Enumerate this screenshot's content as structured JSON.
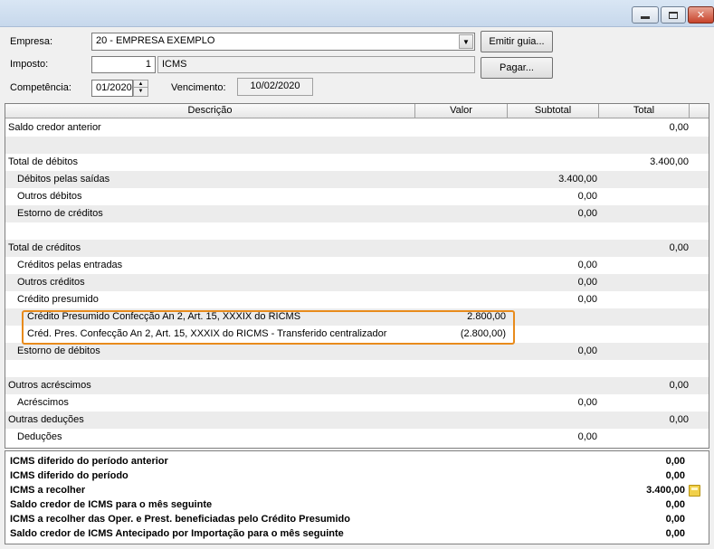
{
  "window": {
    "min_glyph": "",
    "close_glyph": "✕"
  },
  "form": {
    "empresa_label": "Empresa:",
    "empresa_value": "20 - EMPRESA EXEMPLO",
    "imposto_label": "Imposto:",
    "imposto_code": "1",
    "imposto_name": "ICMS",
    "competencia_label": "Competência:",
    "competencia_value": "01/2020",
    "vencimento_label": "Vencimento:",
    "vencimento_value": "10/02/2020",
    "emitir_button": "Emitir guia...",
    "pagar_button": "Pagar..."
  },
  "grid": {
    "columns": [
      "Descrição",
      "Valor",
      "Subtotal",
      "Total"
    ],
    "rows": [
      {
        "desc": "Saldo credor anterior",
        "valor": "",
        "subtotal": "",
        "total": "0,00"
      },
      {
        "desc": "",
        "valor": "",
        "subtotal": "",
        "total": ""
      },
      {
        "desc": "Total de débitos",
        "valor": "",
        "subtotal": "",
        "total": "3.400,00"
      },
      {
        "desc": "Débitos pelas saídas",
        "valor": "",
        "subtotal": "3.400,00",
        "total": ""
      },
      {
        "desc": "Outros débitos",
        "valor": "",
        "subtotal": "0,00",
        "total": ""
      },
      {
        "desc": "Estorno de créditos",
        "valor": "",
        "subtotal": "0,00",
        "total": ""
      },
      {
        "desc": "",
        "valor": "",
        "subtotal": "",
        "total": ""
      },
      {
        "desc": "Total de créditos",
        "valor": "",
        "subtotal": "",
        "total": "0,00"
      },
      {
        "desc": "Créditos pelas entradas",
        "valor": "",
        "subtotal": "0,00",
        "total": ""
      },
      {
        "desc": "Outros créditos",
        "valor": "",
        "subtotal": "0,00",
        "total": ""
      },
      {
        "desc": "Crédito presumido",
        "valor": "",
        "subtotal": "0,00",
        "total": ""
      },
      {
        "desc": "Crédito Presumido Confecção An 2, Art. 15, XXXIX do RICMS",
        "valor": "2.800,00",
        "subtotal": "",
        "total": ""
      },
      {
        "desc": "Créd. Pres. Confecção An 2, Art. 15, XXXIX do RICMS - Transferido centralizador",
        "valor": "(2.800,00)",
        "subtotal": "",
        "total": ""
      },
      {
        "desc": "Estorno de débitos",
        "valor": "",
        "subtotal": "0,00",
        "total": ""
      },
      {
        "desc": "",
        "valor": "",
        "subtotal": "",
        "total": ""
      },
      {
        "desc": "Outros acréscimos",
        "valor": "",
        "subtotal": "",
        "total": "0,00"
      },
      {
        "desc": "Acréscimos",
        "valor": "",
        "subtotal": "0,00",
        "total": ""
      },
      {
        "desc": "Outras deduções",
        "valor": "",
        "subtotal": "",
        "total": "0,00"
      },
      {
        "desc": "Deduções",
        "valor": "",
        "subtotal": "0,00",
        "total": ""
      }
    ]
  },
  "summary": [
    {
      "label": "ICMS diferido do período anterior",
      "value": "0,00"
    },
    {
      "label": "ICMS diferido do período",
      "value": "0,00"
    },
    {
      "label": "ICMS a recolher",
      "value": "3.400,00"
    },
    {
      "label": "Saldo credor de ICMS para o mês seguinte",
      "value": "0,00"
    },
    {
      "label": "ICMS a recolher das Oper. e Prest. beneficiadas pelo Crédito Presumido",
      "value": "0,00"
    },
    {
      "label": "Saldo credor de ICMS Antecipado por Importação para o mês seguinte",
      "value": "0,00"
    }
  ],
  "icons": {
    "calculator": "calculator-icon",
    "highlight_color": "#e88b1c"
  }
}
